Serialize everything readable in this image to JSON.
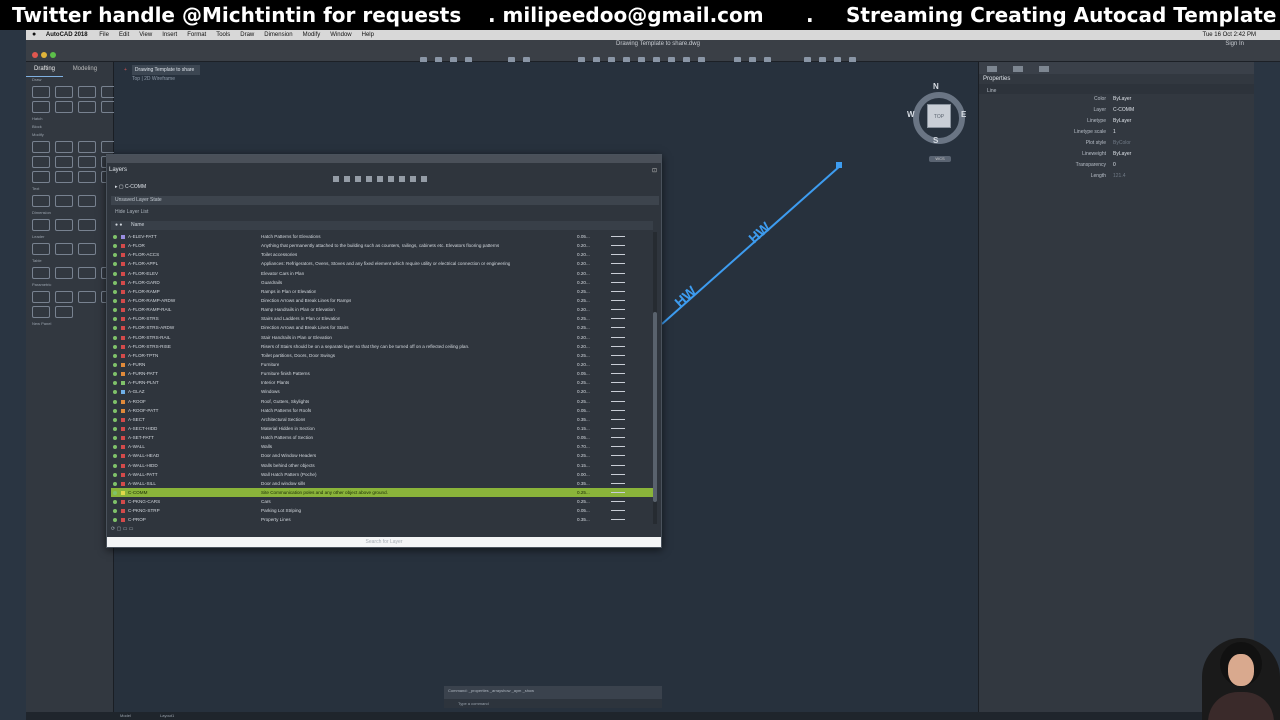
{
  "banner": {
    "part1": "Twitter handle @Michtintin for requests",
    "part2": ". milipeedoo@gmail.com",
    "part3": ".",
    "part4": "Streaming Creating Autocad Template"
  },
  "menubar": {
    "app_name": "AutoCAD 2018",
    "items": [
      "File",
      "Edit",
      "View",
      "Insert",
      "Format",
      "Tools",
      "Draw",
      "Dimension",
      "Modify",
      "Window",
      "Help"
    ],
    "clock": "Tue 16 Oct  2:42 PM"
  },
  "toolbar": {
    "doc_title": "Drawing Template to share.dwg",
    "signin": "Sign In"
  },
  "palette": {
    "tabs": [
      "Drafting",
      "Modeling"
    ],
    "sections": [
      "Draw",
      "Hatch",
      "Block",
      "Modify",
      "Text",
      "Dimension",
      "Leader",
      "Table",
      "Parametric",
      "New Panel"
    ]
  },
  "drawing": {
    "file_tab": "Drawing Template to share",
    "view_label": "Top | 2D Wireframe",
    "viewcube": {
      "top": "TOP",
      "north": "N",
      "south": "S",
      "east": "E",
      "west": "W",
      "wcs": "WCS"
    },
    "line_labels": [
      "HW",
      "HW"
    ],
    "line_color": "#3d9cf0"
  },
  "cmdline": {
    "history": "Command: _properties  _arrayshow  _aym _show",
    "placeholder": "Type a command"
  },
  "layers": {
    "title": "Layers",
    "current_layer": "C-COMM",
    "layer_state": "Unsaved Layer State",
    "filter": "Hide Layer List",
    "column_name": "Name",
    "search_placeholder": "Search for Layer",
    "rows": [
      {
        "name": "A-ELEV-PATT",
        "desc": "Hatch Patterns for Elevations",
        "lw": "0.05...",
        "color": "#9a8de0"
      },
      {
        "name": "A-FLOR",
        "desc": "Anything that permanently attached to the building such as counters, railings, cabinets etc. Elevators flooring patterns",
        "lw": "0.20...",
        "color": "#d34a4a"
      },
      {
        "name": "A-FLOR-ACCS",
        "desc": "Toilet accessories",
        "lw": "0.20...",
        "color": "#d34a4a"
      },
      {
        "name": "A-FLOR-APPL",
        "desc": "Appliances: Refrigerators, Ovens, Stoves and any fixed element which require utility or electrical connection or engineering",
        "lw": "0.20...",
        "color": "#d34a4a"
      },
      {
        "name": "A-FLOR-ELEV",
        "desc": "Elevator Cars in Plan",
        "lw": "0.20...",
        "color": "#d34a4a"
      },
      {
        "name": "A-FLOR-GARD",
        "desc": "Guardrails",
        "lw": "0.20...",
        "color": "#d34a4a"
      },
      {
        "name": "A-FLOR-RAMP",
        "desc": "Ramps in Plan or Elevation",
        "lw": "0.25...",
        "color": "#d34a4a"
      },
      {
        "name": "A-FLOR-RAMP-ARDW",
        "desc": "Direction Arrows and Break Lines for Ramps",
        "lw": "0.25...",
        "color": "#d34a4a"
      },
      {
        "name": "A-FLOR-RAMP-RAIL",
        "desc": "Ramp Handrails in Plan or Elevation",
        "lw": "0.20...",
        "color": "#d34a4a"
      },
      {
        "name": "A-FLOR-STRS",
        "desc": "Stairs and Ladders in Plan or Elevation",
        "lw": "0.25...",
        "color": "#d34a4a"
      },
      {
        "name": "A-FLOR-STRS-ARDW",
        "desc": "Direction Arrows and Break Lines for Stairs",
        "lw": "0.25...",
        "color": "#d34a4a"
      },
      {
        "name": "A-FLOR-STRS-RAIL",
        "desc": "Stair Handrails in Plan or Elevation",
        "lw": "0.20...",
        "color": "#d34a4a"
      },
      {
        "name": "A-FLOR-STRS-RISE",
        "desc": "Risers of Stairs should be on a separate layer so that they can be turned off on a reflected ceiling plan.",
        "lw": "0.20...",
        "color": "#d34a4a"
      },
      {
        "name": "A-FLOR-TPTN",
        "desc": "Toilet partitions, Doors, Door Swings",
        "lw": "0.25...",
        "color": "#d34a4a"
      },
      {
        "name": "A-FURN",
        "desc": "Furniture",
        "lw": "0.20...",
        "color": "#e08a3a"
      },
      {
        "name": "A-FURN-PATT",
        "desc": "Furniture finish Patterns",
        "lw": "0.05...",
        "color": "#e08a3a"
      },
      {
        "name": "A-FURN-PLNT",
        "desc": "Interior Plants",
        "lw": "0.25...",
        "color": "#7fc26a"
      },
      {
        "name": "A-GLAZ",
        "desc": "Windows",
        "lw": "0.20...",
        "color": "#6fb0e8"
      },
      {
        "name": "A-ROOF",
        "desc": "Roof, Gutters, Skylights",
        "lw": "0.25...",
        "color": "#e08a3a"
      },
      {
        "name": "A-ROOF-PATT",
        "desc": "Hatch Patterns for Roofs",
        "lw": "0.05...",
        "color": "#e08a3a"
      },
      {
        "name": "A-SECT",
        "desc": "Architectural Sections",
        "lw": "0.35...",
        "color": "#d34a4a"
      },
      {
        "name": "A-SECT-HIDD",
        "desc": "Material Hidden in Section",
        "lw": "0.15...",
        "color": "#d34a4a"
      },
      {
        "name": "A-SET-PATT",
        "desc": "Hatch Patterns of Section",
        "lw": "0.05...",
        "color": "#d34a4a"
      },
      {
        "name": "A-WALL",
        "desc": "Walls",
        "lw": "0.70...",
        "color": "#d34a4a"
      },
      {
        "name": "A-WALL-HEAD",
        "desc": "Door and Window Headers",
        "lw": "0.25...",
        "color": "#d34a4a"
      },
      {
        "name": "A-WALL-HIDD",
        "desc": "Walls behind other objects",
        "lw": "0.15...",
        "color": "#d34a4a"
      },
      {
        "name": "A-WALL-PATT",
        "desc": "Wall Hatch Pattern (Poche)",
        "lw": "0.00...",
        "color": "#d34a4a"
      },
      {
        "name": "A-WALL-SILL",
        "desc": "Door and window sills",
        "lw": "0.35...",
        "color": "#d34a4a"
      },
      {
        "name": "C-COMM",
        "desc": "Site Communication poles and any other object above ground.",
        "lw": "0.25...",
        "color": "#e0d94a",
        "selected": true
      },
      {
        "name": "C-PKNG-CARS",
        "desc": "Cars",
        "lw": "0.25...",
        "color": "#d34a4a"
      },
      {
        "name": "C-PKNG-STRP",
        "desc": "Parking Lot Striping",
        "lw": "0.05...",
        "color": "#d34a4a"
      },
      {
        "name": "C-PROP",
        "desc": "Property Lines",
        "lw": "0.35...",
        "color": "#d34a4a"
      }
    ]
  },
  "properties": {
    "title": "Properties",
    "object": "Line",
    "fields": [
      {
        "key": "Color",
        "value": "ByLayer"
      },
      {
        "key": "Layer",
        "value": "C-COMM"
      },
      {
        "key": "Linetype",
        "value": "ByLayer"
      },
      {
        "key": "Linetype scale",
        "value": "1"
      },
      {
        "key": "Plot style",
        "value": "ByColor",
        "dim": true
      },
      {
        "key": "Lineweight",
        "value": "ByLayer"
      },
      {
        "key": "Transparency",
        "value": "0"
      },
      {
        "key": "Length",
        "value": "121.4",
        "dim": true
      }
    ]
  },
  "statusbar": {
    "model_tab": "Model",
    "layout_tab": "Layout1"
  }
}
